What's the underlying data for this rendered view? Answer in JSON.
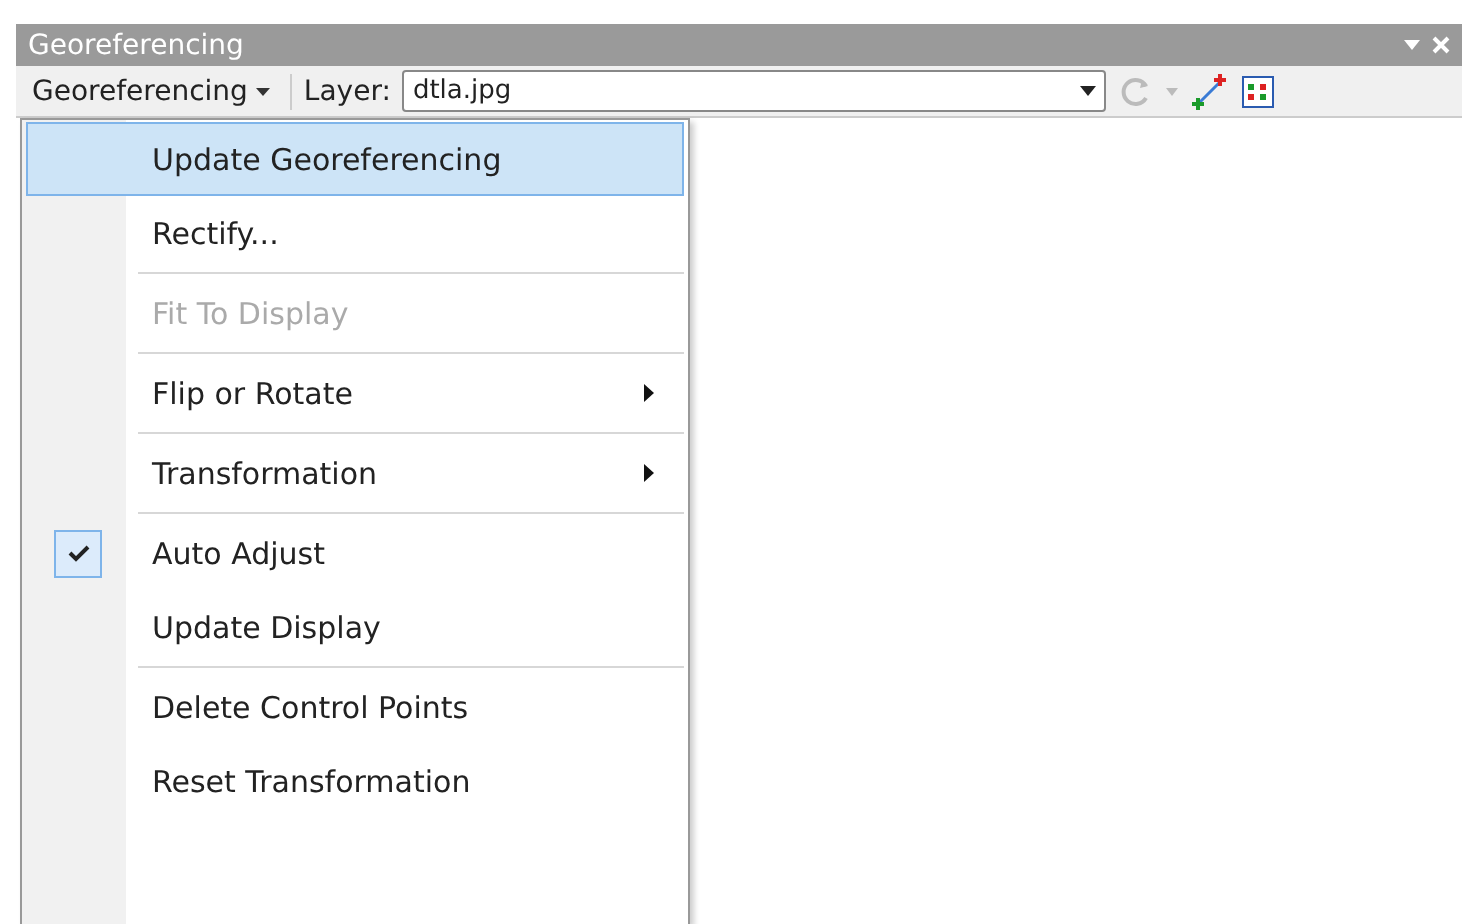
{
  "window": {
    "title": "Georeferencing"
  },
  "toolbar": {
    "menu_button": "Georeferencing",
    "layer_label": "Layer:",
    "layer_value": "dtla.jpg"
  },
  "menu": {
    "items": [
      {
        "kind": "item",
        "label": "Update Georeferencing",
        "selected": true,
        "checked": false,
        "disabled": false,
        "submenu": false
      },
      {
        "kind": "item",
        "label": "Rectify...",
        "selected": false,
        "checked": false,
        "disabled": false,
        "submenu": false
      },
      {
        "kind": "separator"
      },
      {
        "kind": "item",
        "label": "Fit To Display",
        "selected": false,
        "checked": false,
        "disabled": true,
        "submenu": false
      },
      {
        "kind": "separator"
      },
      {
        "kind": "item",
        "label": "Flip or Rotate",
        "selected": false,
        "checked": false,
        "disabled": false,
        "submenu": true
      },
      {
        "kind": "separator"
      },
      {
        "kind": "item",
        "label": "Transformation",
        "selected": false,
        "checked": false,
        "disabled": false,
        "submenu": true
      },
      {
        "kind": "separator"
      },
      {
        "kind": "item",
        "label": "Auto Adjust",
        "selected": false,
        "checked": true,
        "disabled": false,
        "submenu": false
      },
      {
        "kind": "item",
        "label": "Update Display",
        "selected": false,
        "checked": false,
        "disabled": false,
        "submenu": false
      },
      {
        "kind": "separator"
      },
      {
        "kind": "item",
        "label": "Delete Control Points",
        "selected": false,
        "checked": false,
        "disabled": false,
        "submenu": false
      },
      {
        "kind": "item",
        "label": "Reset Transformation",
        "selected": false,
        "checked": false,
        "disabled": false,
        "submenu": false
      }
    ]
  }
}
